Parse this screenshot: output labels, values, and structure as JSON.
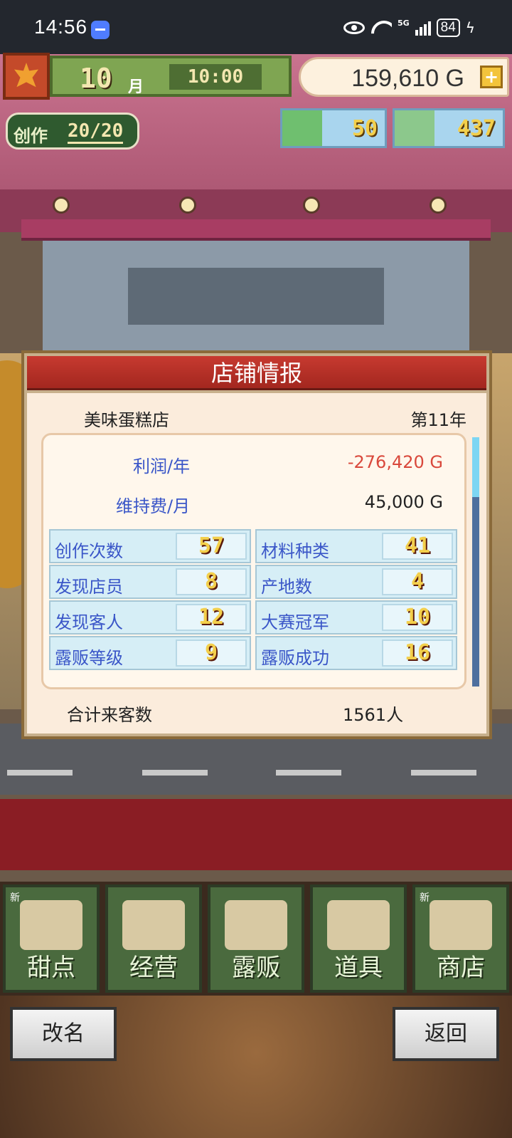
{
  "status_bar": {
    "time": "14:56",
    "network": "5G",
    "battery": "84"
  },
  "hud": {
    "month": "10",
    "month_unit": "月",
    "clock": "10:00",
    "gold": "159,610 G",
    "create_label": "创作",
    "create_value": "20/20",
    "gold_bars": "50",
    "coins": "437"
  },
  "dialog": {
    "title": "店铺情报",
    "shop_name": "美味蛋糕店",
    "year": "第11年",
    "profit_label": "利润/年",
    "profit_value": "-276,420 G",
    "upkeep_label": "维持费/月",
    "upkeep_value": "45,000 G",
    "stats": [
      {
        "label": "创作次数",
        "value": "57"
      },
      {
        "label": "材料种类",
        "value": "41"
      },
      {
        "label": "发现店员",
        "value": "8"
      },
      {
        "label": "产地数",
        "value": "4"
      },
      {
        "label": "发现客人",
        "value": "12"
      },
      {
        "label": "大赛冠军",
        "value": "10"
      },
      {
        "label": "露贩等级",
        "value": "9"
      },
      {
        "label": "露贩成功",
        "value": "16"
      }
    ],
    "total_label": "合计来客数",
    "total_value": "1561人"
  },
  "menu": [
    {
      "label": "甜点",
      "new": "新"
    },
    {
      "label": "经营",
      "new": ""
    },
    {
      "label": "露贩",
      "new": ""
    },
    {
      "label": "道具",
      "new": ""
    },
    {
      "label": "商店",
      "new": "新"
    }
  ],
  "footer": {
    "rename": "改名",
    "back": "返回"
  }
}
